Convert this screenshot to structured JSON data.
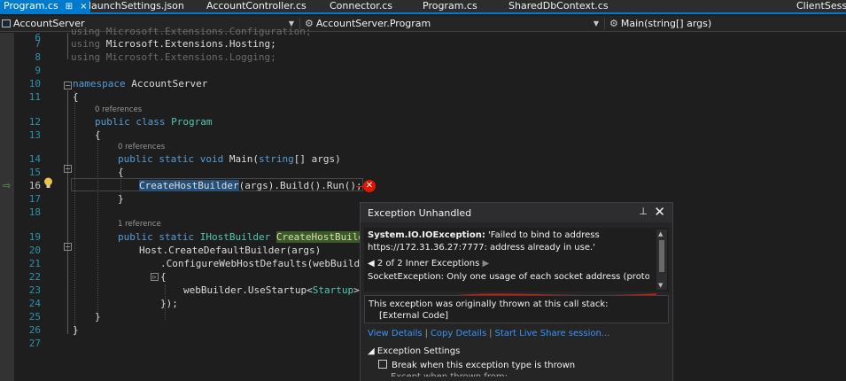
{
  "tabs": [
    {
      "label": "Program.cs",
      "active": true,
      "pin": "⊞",
      "close": "×"
    },
    {
      "label": "launchSettings.json"
    },
    {
      "label": "AccountController.cs"
    },
    {
      "label": "Connector.cs"
    },
    {
      "label": "Program.cs"
    },
    {
      "label": "SharedDbContext.cs"
    },
    {
      "label": "ClientSessio"
    }
  ],
  "nav": {
    "project": "AccountServer",
    "type": "AccountServer.Program",
    "member": "Main(string[] args)"
  },
  "code": {
    "line_numbers": [
      "6",
      "7",
      "8",
      "9",
      "10",
      "11",
      "12",
      "13",
      "14",
      "15",
      "16",
      "17",
      "18",
      "19",
      "20",
      "21",
      "22",
      "23",
      "24",
      "25",
      "26",
      "27"
    ],
    "current_line": "16",
    "hints": {
      "class_refs": "0 references",
      "main_refs": "0 references",
      "builder_refs": "1 reference"
    },
    "partial_top": "using Microsoft.Extensions.Configuration;",
    "l7_using": "using",
    "l7_ns": " Microsoft.Extensions.Hosting;",
    "l8_using": "using",
    "l8_ns": " Microsoft.Extensions.Logging;",
    "l10_kw": "namespace",
    "l10_name": " AccountServer",
    "brace_open": "{",
    "brace_close": "}",
    "l12_kw": "public class",
    "l12_name": " Program",
    "l14_kw": "public static void",
    "l14_rest": " Main(",
    "l14_kw2": "string",
    "l14_rest2": "[] args)",
    "l16_sel": "CreateHostBuilder",
    "l16_rest": "(args).Build().Run();",
    "l19_kw": "public static",
    "l19_ty": " IHostBuilder ",
    "l19_hl": "CreateHostBuilde",
    "l20": "Host.CreateDefaultBuilder(args)",
    "l21": ".ConfigureWebHostDefaults(webBuilde",
    "l22": "{",
    "l23_a": "webBuilder.UseStartup<",
    "l23_ty": "Startup",
    "l23_b": ">(",
    "l24": "});"
  },
  "exception": {
    "title": "Exception Unhandled",
    "pin_icon": "⊥",
    "close_icon": "✕",
    "type": "System.IO.IOException:",
    "message": " 'Failed to bind to address https://172.31.36.27:7777: address already in use.'",
    "inner_nav": "2 of 2 Inner Exceptions",
    "inner_message": "SocketException: Only one usage of each socket address (protocol/network address/port) is normally permitted",
    "stack_header": "This exception was originally thrown at this call stack:",
    "stack_item": "[External Code]",
    "links": [
      "View Details",
      "Copy Details",
      "Start Live Share session..."
    ],
    "settings_header": "Exception Settings",
    "break_option": "Break when this exception type is thrown",
    "cut_option": "Except when thrown from:"
  },
  "colors": {
    "accent": "#007acc",
    "error": "#e51400",
    "link": "#3794ff",
    "keyword": "#569cd6",
    "type": "#4ec9b0"
  }
}
